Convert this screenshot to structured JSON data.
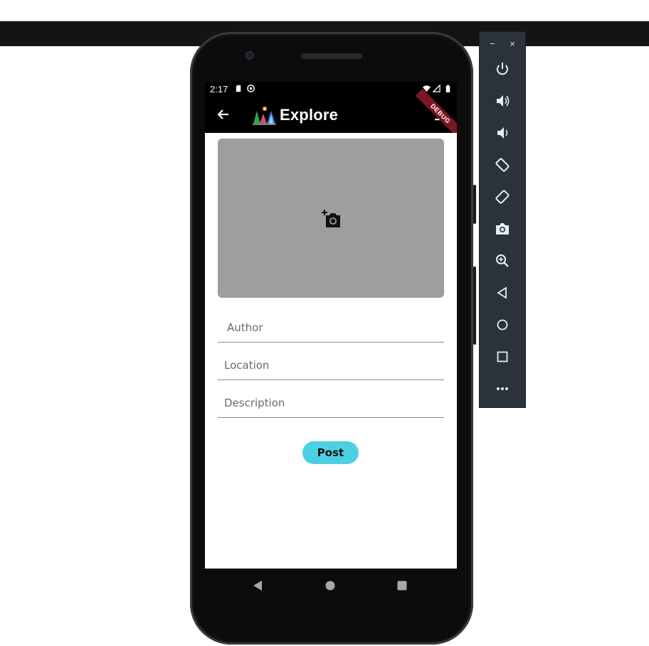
{
  "device": {
    "status_time": "2:17",
    "debug_banner": "DEBUG"
  },
  "appbar": {
    "title": "Explore",
    "back_icon": "arrow-back-icon",
    "upload_icon": "upload-icon",
    "logo": "tree-fireworks-logo"
  },
  "form": {
    "image_picker_icon": "add-a-photo-icon",
    "author_placeholder": "Author",
    "location_placeholder": "Location",
    "description_placeholder": "Description",
    "post_label": "Post"
  },
  "android_nav": [
    "back-triangle-icon",
    "home-circle-icon",
    "recents-square-icon"
  ],
  "emulator_panel": {
    "minimize": "−",
    "close": "×",
    "tools": [
      "power-icon",
      "volume-up-icon",
      "volume-down-icon",
      "rotate-left-icon",
      "rotate-right-icon",
      "screenshot-camera-icon",
      "zoom-icon",
      "back-icon",
      "home-icon",
      "overview-icon",
      "more-icon"
    ]
  },
  "colors": {
    "post_button": "#4ccfe2",
    "image_picker_bg": "#9e9e9e",
    "emulator_panel_bg": "#2b3239",
    "debug_banner": "#7a1521"
  }
}
